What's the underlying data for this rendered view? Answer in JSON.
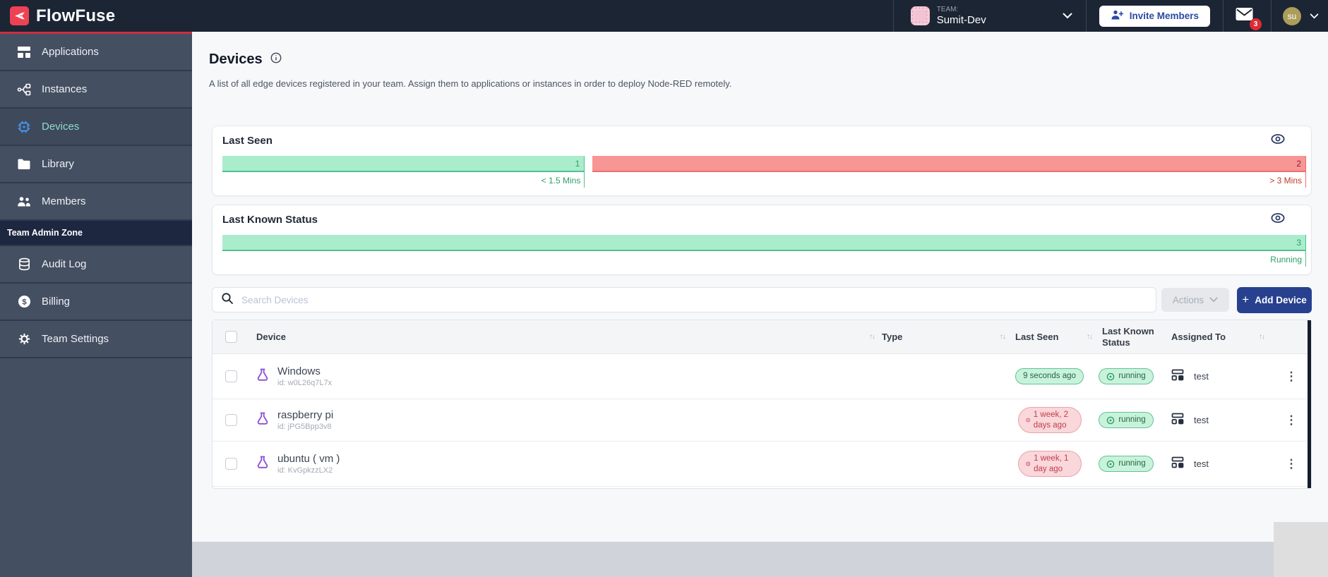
{
  "topbar": {
    "brand": "FlowFuse",
    "team": {
      "label": "TEAM:",
      "name": "Sumit-Dev"
    },
    "invite_label": "Invite Members",
    "notification_count": "3",
    "user_initials": "su"
  },
  "sidebar": {
    "items": [
      {
        "label": "Applications"
      },
      {
        "label": "Instances"
      },
      {
        "label": "Devices"
      },
      {
        "label": "Library"
      },
      {
        "label": "Members"
      }
    ],
    "admin_zone_label": "Team Admin Zone",
    "admin_items": [
      {
        "label": "Audit Log"
      },
      {
        "label": "Billing"
      },
      {
        "label": "Team Settings"
      }
    ]
  },
  "page": {
    "title": "Devices",
    "subtitle": "A list of all edge devices registered in your team. Assign them to applications or instances in order to deploy Node-RED remotely."
  },
  "last_seen_chart": {
    "title": "Last Seen",
    "segments": [
      {
        "value": "1",
        "caption": "< 1.5 Mins",
        "tone": "green"
      },
      {
        "value": "2",
        "caption": "> 3 Mins",
        "tone": "red"
      }
    ]
  },
  "status_chart": {
    "title": "Last Known Status",
    "segments": [
      {
        "value": "3",
        "caption": "Running",
        "tone": "green"
      }
    ]
  },
  "toolbar": {
    "search_placeholder": "Search Devices",
    "actions_label": "Actions",
    "add_device_label": "Add Device"
  },
  "table": {
    "columns": [
      "Device",
      "Type",
      "Last Seen",
      "Last Known Status",
      "Assigned To"
    ],
    "rows": [
      {
        "name": "Windows",
        "id": "id: w0L26q7L7x",
        "last_seen": "9 seconds ago",
        "last_seen_tone": "green",
        "status": "running",
        "assigned_to": "test"
      },
      {
        "name": "raspberry pi",
        "id": "id: jPG5Bpp3v8",
        "last_seen": "1 week, 2 days ago",
        "last_seen_tone": "red",
        "status": "running",
        "assigned_to": "test"
      },
      {
        "name": "ubuntu ( vm )",
        "id": "id: KvGpkzzLX2",
        "last_seen": "1 week, 1 day ago",
        "last_seen_tone": "red",
        "status": "running",
        "assigned_to": "test"
      }
    ]
  },
  "icons": {
    "sort": "↑↓",
    "kebab": "⋮"
  },
  "colors": {
    "navbar": "#1c2534",
    "sidebar": "#454f62",
    "brand_red": "#ef4154",
    "accent_line": "#cf2d43",
    "green_fill": "#a9edcc",
    "red_fill": "#f89595",
    "primary_button": "#27418f",
    "active_item_icon": "#459cf7",
    "active_item_text": "#8fdcca"
  }
}
